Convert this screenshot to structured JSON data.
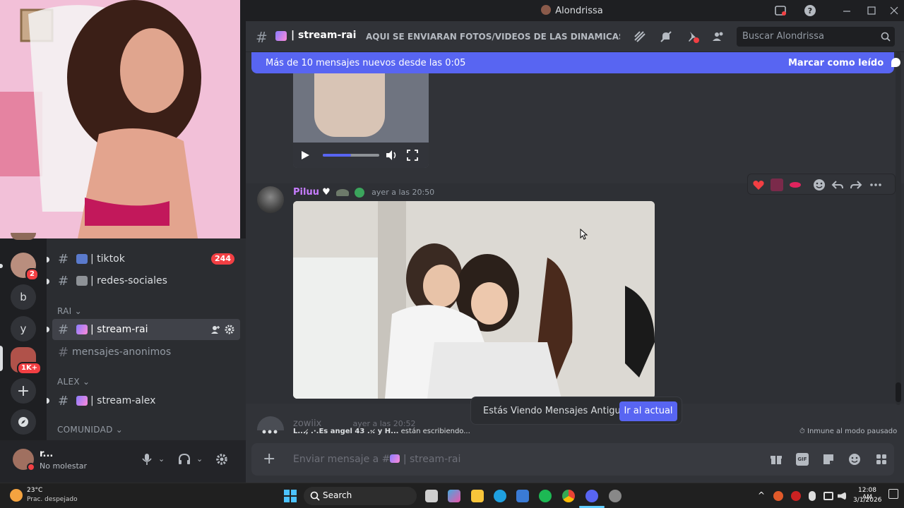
{
  "window": {
    "title": "Alondrissa"
  },
  "channel_header": {
    "channel_name": "stream-rai",
    "topic": "AQUI SE ENVIARAN FOTOS/VIDEOS DE LAS DINAMICAS DEL ...",
    "search_placeholder": "Buscar Alondrissa"
  },
  "new_messages": {
    "text": "Más de 10 mensajes nuevos desde las 0:05",
    "mark_read": "Marcar como leído"
  },
  "message": {
    "author": "Piluu",
    "timestamp": "ayer a las 20:50"
  },
  "next_message": {
    "author": "zowiix",
    "timestamp": "ayer a las 20:52"
  },
  "old_messages_toast": {
    "text": "Estás Viendo Mensajes Antiguos",
    "button": "Ir al actual"
  },
  "typing": {
    "text_bold": "L...,̷ .·.Es angel 43 .·.̷ y H...",
    "text": "están escribiendo...",
    "immune": "Inmune al modo pausado"
  },
  "composer": {
    "placeholder": "Enviar mensaje a #",
    "channel": "stream-rai"
  },
  "channels": [
    {
      "name": "tiktok",
      "badge": "244"
    },
    {
      "name": "redes-sociales"
    },
    {
      "category": "RAI"
    },
    {
      "name": "stream-rai",
      "active": true
    },
    {
      "name": "mensajes-anonimos"
    },
    {
      "category": "ALEX"
    },
    {
      "name": "stream-alex"
    },
    {
      "category": "COMUNIDAD"
    }
  ],
  "rail": {
    "badge_1": "2",
    "server_b": "b",
    "server_y": "y",
    "badge_2": "1K+"
  },
  "user": {
    "name": "r...",
    "status": "No molestar"
  },
  "taskbar": {
    "weather_temp": "23°C",
    "weather_desc": "Prac. despejado",
    "search": "Search",
    "time": "12:08 AM",
    "date": "3/1/2026"
  },
  "colors": {
    "blurple": "#5865f2",
    "danger": "#f23f43",
    "author": "#c77dff"
  }
}
